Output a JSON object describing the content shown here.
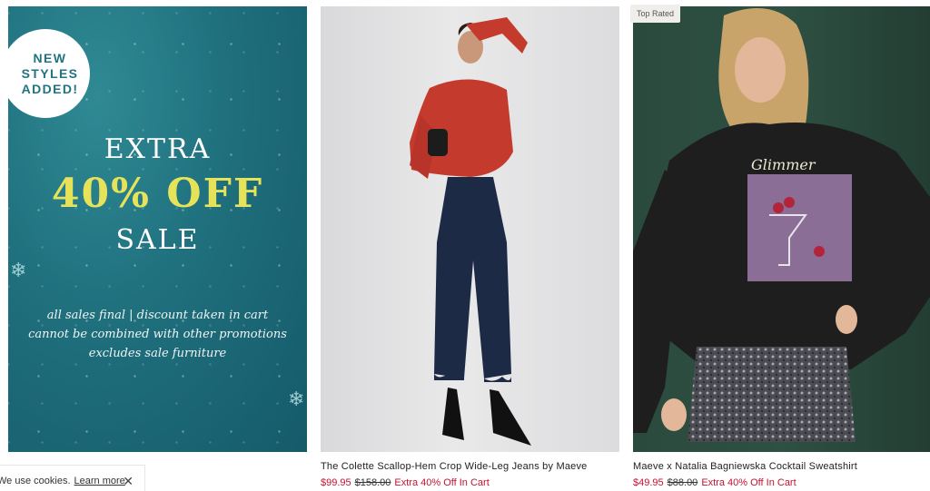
{
  "promo": {
    "badge_lines": [
      "NEW",
      "STYLES",
      "ADDED!"
    ],
    "title_line1": "EXTRA",
    "title_line2": "40% OFF",
    "title_line3": "SALE",
    "fine_line1": "all sales final  |  discount taken in cart",
    "fine_line2": "cannot be combined with other promotions",
    "fine_line3": "excludes sale furniture"
  },
  "products": [
    {
      "name": "The Colette Scallop-Hem Crop Wide-Leg Jeans by Maeve",
      "sale_price": "$99.95",
      "original_price": "$158.00",
      "promo": "Extra 40% Off In Cart"
    },
    {
      "badge": "Top Rated",
      "name": "Maeve x Natalia Bagniewska Cocktail Sweatshirt",
      "sale_price": "$49.95",
      "original_price": "$88.00",
      "promo": "Extra 40% Off In Cart",
      "graphic_text": "Glimmer"
    }
  ],
  "cookie": {
    "text": "We use cookies.",
    "link": "Learn more",
    "close": "✕"
  },
  "colors": {
    "sale_red": "#c8102e",
    "promo_teal": "#1f6f7d",
    "promo_yellow": "#e6e35a"
  }
}
